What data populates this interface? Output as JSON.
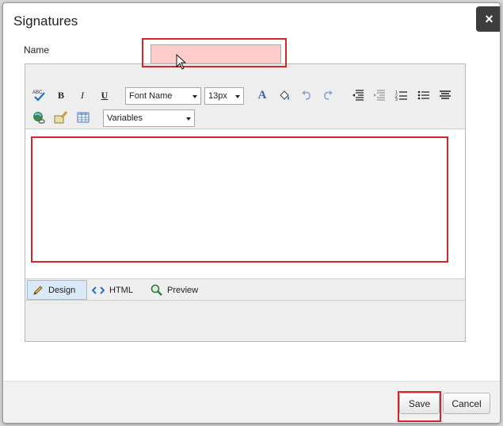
{
  "dialog": {
    "title": "Signatures",
    "close_label": "×"
  },
  "form": {
    "name_label": "Name",
    "name_value": ""
  },
  "toolbar": {
    "font_name": "Font Name",
    "font_size": "13px",
    "variables": "Variables",
    "icons": [
      "spellcheck-icon",
      "bold-icon",
      "italic-icon",
      "underline-icon",
      "font-color-icon",
      "highlight-icon",
      "undo-icon",
      "redo-icon",
      "outdent-icon",
      "indent-icon",
      "ordered-list-icon",
      "unordered-list-icon",
      "justify-icon",
      "insert-link-icon",
      "clean-html-icon",
      "insert-table-icon"
    ],
    "bold": "B",
    "italic": "I",
    "underline": "U",
    "font_color": "A"
  },
  "editor": {
    "content": ""
  },
  "modes": [
    {
      "label": "Design",
      "active": true
    },
    {
      "label": "HTML",
      "active": false
    },
    {
      "label": "Preview",
      "active": false
    }
  ],
  "footer": {
    "save_label": "Save",
    "cancel_label": "Cancel"
  },
  "colors": {
    "highlight": "#d8232a",
    "name_field_bg": "#ffcccc",
    "close_bg": "#3d3d3d"
  }
}
